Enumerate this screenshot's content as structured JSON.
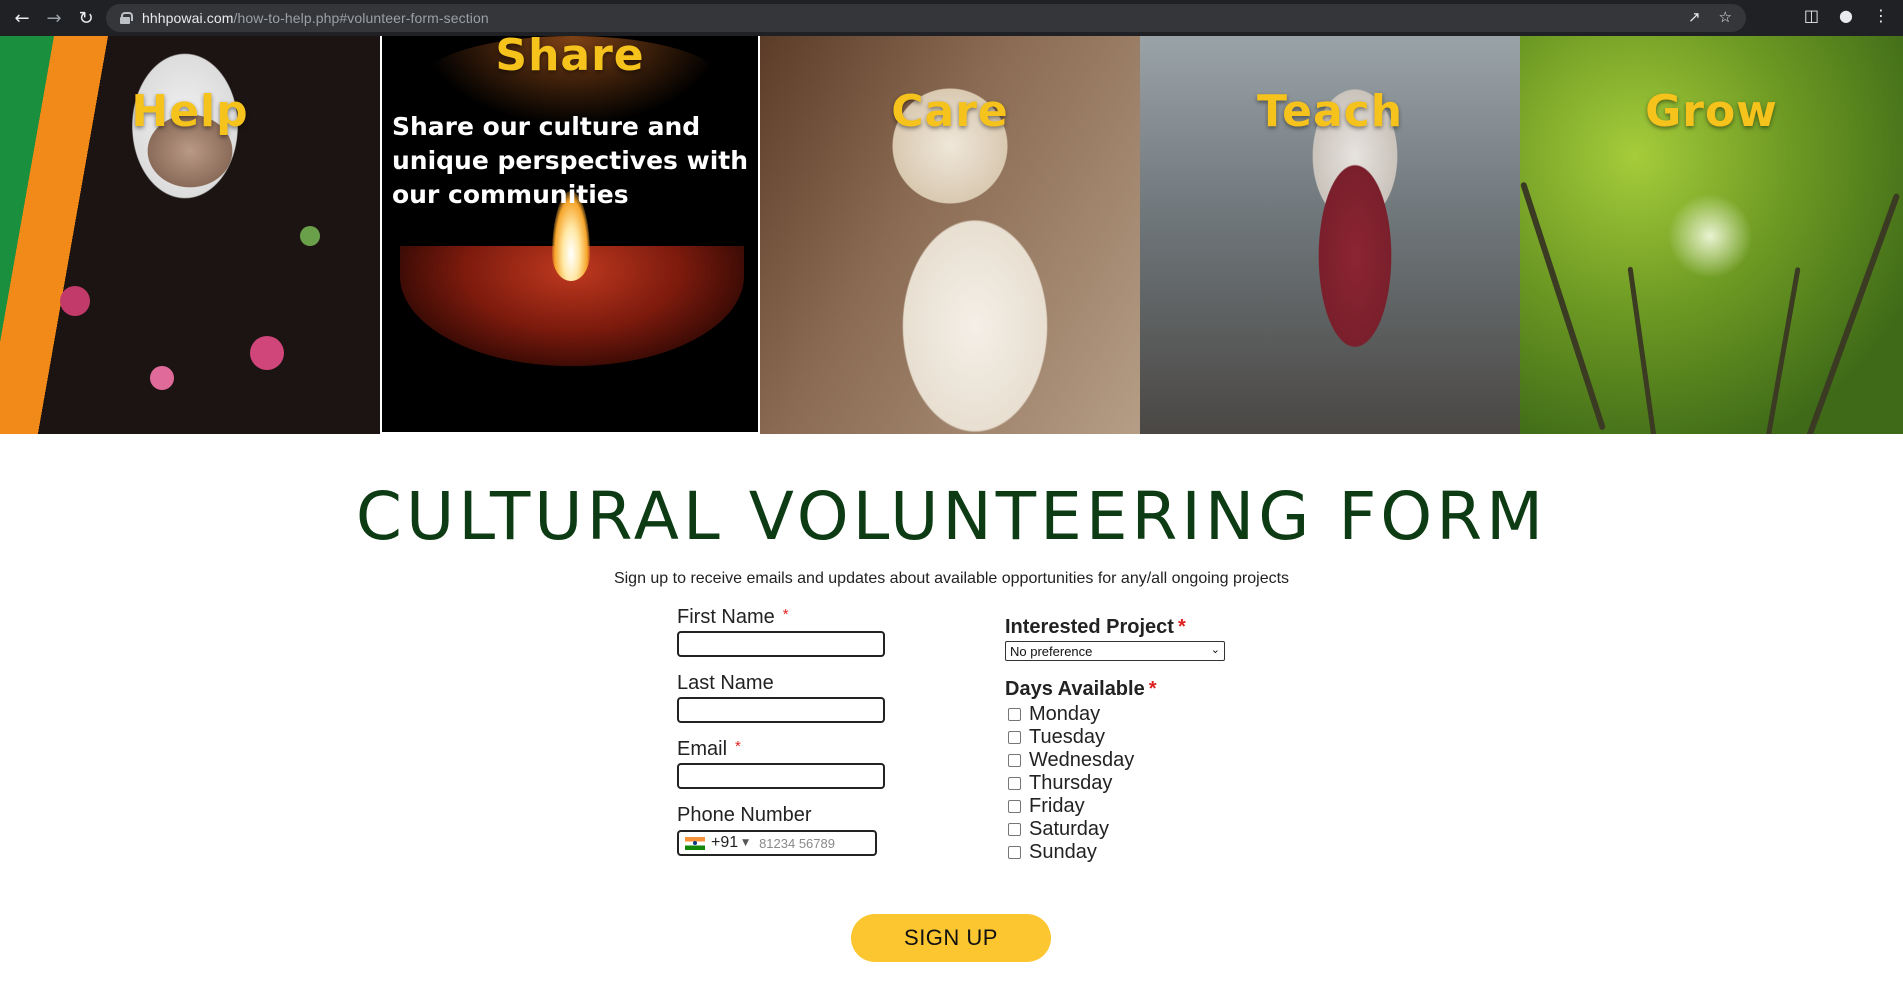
{
  "browser": {
    "url_domain": "hhhpowai.com",
    "url_path": "/how-to-help.php#volunteer-form-section",
    "icons": [
      "back-icon",
      "forward-icon",
      "reload-icon",
      "lock-icon",
      "share-icon",
      "star-icon",
      "side-panel-icon",
      "profile-icon",
      "menu-icon"
    ]
  },
  "hero": {
    "tiles": [
      {
        "title": "Help"
      },
      {
        "title": "Share",
        "description": "Share our culture and unique perspectives with our communities"
      },
      {
        "title": "Care"
      },
      {
        "title": "Teach"
      },
      {
        "title": "Grow"
      }
    ],
    "title_color": "#f6c21c"
  },
  "form": {
    "title": "CULTURAL VOLUNTEERING FORM",
    "subtitle": "Sign up to receive emails and updates about available opportunities for any/all ongoing projects",
    "required_marker": "*",
    "first_name_label": "First Name",
    "last_name_label": "Last Name",
    "email_label": "Email",
    "phone_label": "Phone Number",
    "phone_dial_code": "+91",
    "phone_placeholder": "81234 56789",
    "interested_project_label": "Interested Project",
    "interested_project_value": "No preference",
    "days_label": "Days Available",
    "days": [
      "Monday",
      "Tuesday",
      "Wednesday",
      "Thursday",
      "Friday",
      "Saturday",
      "Sunday"
    ],
    "submit_label": "SIGN UP",
    "title_color": "#0d3b14",
    "button_color": "#fcc630"
  }
}
